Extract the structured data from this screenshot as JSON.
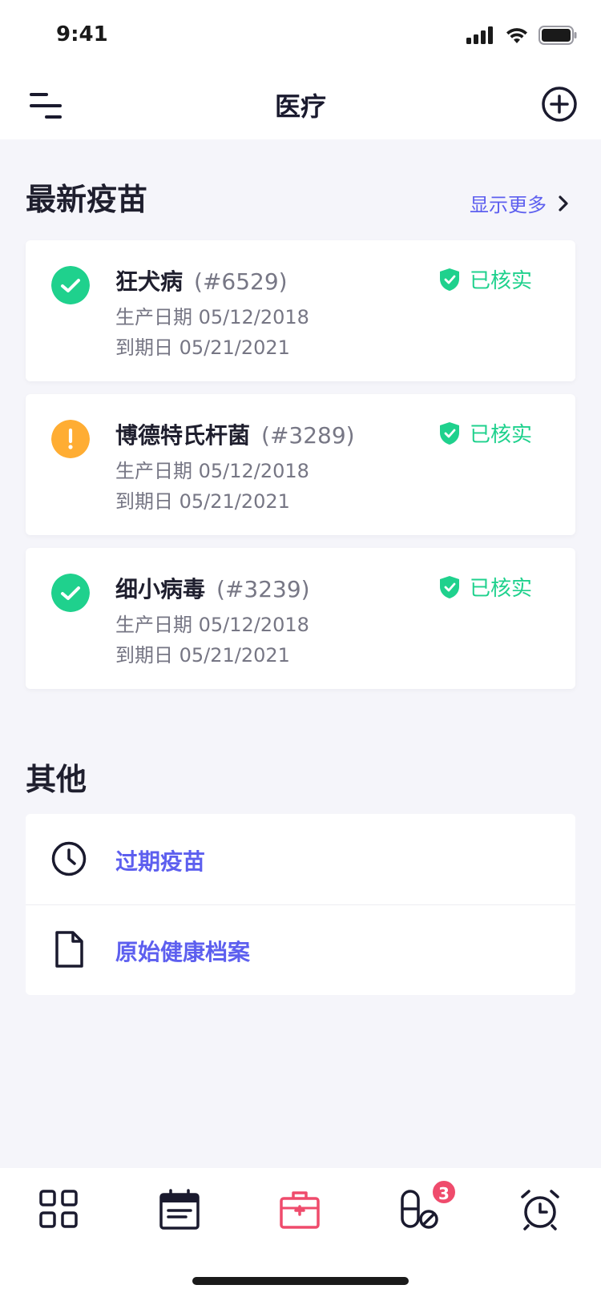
{
  "status_bar": {
    "time": "9:41"
  },
  "nav": {
    "title": "医疗"
  },
  "recent": {
    "title": "最新疫苗",
    "show_more": "显示更多",
    "items": [
      {
        "name": "狂犬病",
        "code": "(#6529)",
        "production": "生产日期 05/12/2018",
        "expiry": "到期日 05/21/2021",
        "status": "ok",
        "verified": "已核实"
      },
      {
        "name": "博德特氏杆菌",
        "code": "(#3289)",
        "production": "生产日期 05/12/2018",
        "expiry": "到期日 05/21/2021",
        "status": "warning",
        "verified": "已核实"
      },
      {
        "name": "细小病毒",
        "code": "(#3239)",
        "production": "生产日期 05/12/2018",
        "expiry": "到期日 05/21/2021",
        "status": "ok",
        "verified": "已核实"
      }
    ]
  },
  "other": {
    "title": "其他",
    "items": [
      {
        "label": "过期疫苗",
        "icon": "clock-icon"
      },
      {
        "label": "原始健康档案",
        "icon": "document-icon"
      }
    ]
  },
  "tabs": [
    {
      "name": "dashboard",
      "icon": "grid-icon"
    },
    {
      "name": "calendar",
      "icon": "calendar-icon"
    },
    {
      "name": "medical",
      "icon": "medical-kit-icon",
      "active": true
    },
    {
      "name": "medication",
      "icon": "pill-icon",
      "badge": "3"
    },
    {
      "name": "alarm",
      "icon": "alarm-clock-icon"
    }
  ],
  "colors": {
    "accent": "#5d5fef",
    "verified": "#1fd18d",
    "ok": "#1fd18d",
    "warning": "#ffad33",
    "active_tab": "#ef4b6c"
  }
}
